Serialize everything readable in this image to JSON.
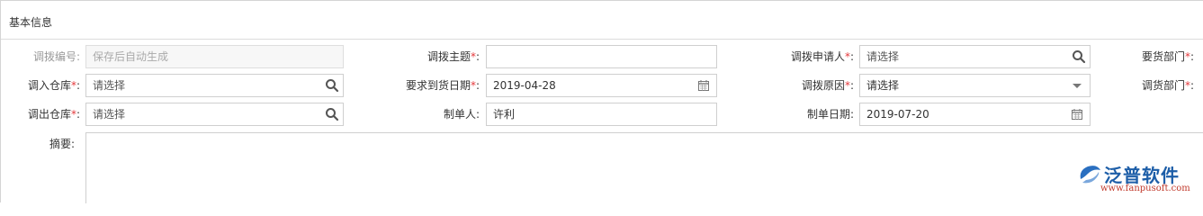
{
  "panel": {
    "title": "基本信息"
  },
  "fields": {
    "transfer_no": {
      "label": "调拨编号:",
      "placeholder": "保存后自动生成"
    },
    "transfer_subject": {
      "label": "调拨主题",
      "value": ""
    },
    "applicant": {
      "label": "调拨申请人",
      "placeholder": "请选择"
    },
    "requesting_dept": {
      "label": "要货部门"
    },
    "in_warehouse": {
      "label": "调入仓库",
      "placeholder": "请选择"
    },
    "required_date": {
      "label": "要求到货日期",
      "value": "2019-04-28"
    },
    "transfer_reason": {
      "label": "调拨原因",
      "value": "请选择"
    },
    "supplying_dept": {
      "label": "调货部门"
    },
    "out_warehouse": {
      "label": "调出仓库",
      "placeholder": "请选择"
    },
    "creator": {
      "label": "制单人:",
      "value": "许利"
    },
    "create_date": {
      "label": "制单日期:",
      "value": "2019-07-20"
    },
    "summary": {
      "label": "摘要:"
    }
  },
  "required_mark": "*",
  "colon": ":",
  "logo": {
    "name": "泛普软件",
    "url": "www.fanpusoft.com"
  },
  "icons": {
    "search": "search-icon",
    "calendar": "calendar-icon",
    "dropdown": "caret-down-icon"
  },
  "colors": {
    "required": "#e4393c",
    "brand_blue": "#1d5ea8",
    "brand_red": "#c0392b"
  }
}
